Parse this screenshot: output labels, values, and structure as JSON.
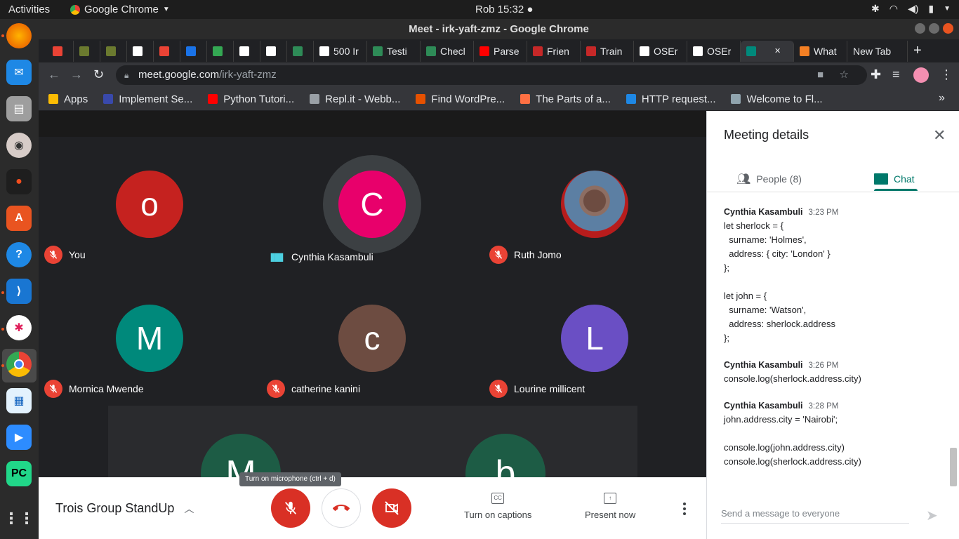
{
  "os": {
    "activities": "Activities",
    "app_name": "Google Chrome",
    "clock": "Rob 15:32 ●"
  },
  "window": {
    "title": "Meet - irk-yaft-zmz - Google Chrome"
  },
  "tabs": [
    {
      "label": "",
      "color": "#ea4335"
    },
    {
      "label": "",
      "color": "#6b7a2f"
    },
    {
      "label": "",
      "color": "#6b7a2f"
    },
    {
      "label": "",
      "color": "#ffffff"
    },
    {
      "label": "",
      "color": "#ea4335"
    },
    {
      "label": "",
      "color": "#1a73e8"
    },
    {
      "label": "",
      "color": "#34a853"
    },
    {
      "label": "",
      "color": "#ffffff"
    },
    {
      "label": "",
      "color": "#ffffff"
    },
    {
      "label": "",
      "color": "#2e8b57"
    },
    {
      "label": "500 Ir",
      "color": "#ffffff"
    },
    {
      "label": "Testi",
      "color": "#2e8b57"
    },
    {
      "label": "Checl",
      "color": "#2e8b57"
    },
    {
      "label": "Parse",
      "color": "#ff0000"
    },
    {
      "label": "Frien",
      "color": "#c62828"
    },
    {
      "label": "Train",
      "color": "#c62828"
    },
    {
      "label": "OSEr",
      "color": "#ffffff"
    },
    {
      "label": "OSEr",
      "color": "#ffffff"
    },
    {
      "label": "",
      "color": "#00897b"
    },
    {
      "label": "What",
      "color": "#f48024"
    },
    {
      "label": "New Tab",
      "color": ""
    }
  ],
  "omnibox": {
    "host": "meet.google.com",
    "path": "/irk-yaft-zmz"
  },
  "bookmarks": [
    {
      "label": "Apps",
      "color": "#fbbc04"
    },
    {
      "label": "Implement Se...",
      "color": "#3949ab"
    },
    {
      "label": "Python Tutori...",
      "color": "#ff0000"
    },
    {
      "label": "Repl.it - Webb...",
      "color": "#9aa0a6"
    },
    {
      "label": "Find WordPre...",
      "color": "#e65100"
    },
    {
      "label": "The Parts of a...",
      "color": "#ff7043"
    },
    {
      "label": "HTTP request...",
      "color": "#1e88e5"
    },
    {
      "label": "Welcome to Fl...",
      "color": "#90a4ae"
    }
  ],
  "participants": [
    {
      "initial": "o",
      "name": "You",
      "color": "#c5221f",
      "muted": true
    },
    {
      "initial": "C",
      "name": "Cynthia Kasambuli",
      "color": "#e8006b",
      "muted": false,
      "speaking": true
    },
    {
      "initial": "",
      "name": "Ruth Jomo",
      "color": "#b71c1c",
      "muted": true,
      "photo": true
    },
    {
      "initial": "M",
      "name": "Mornica Mwende",
      "color": "#00897b",
      "muted": true
    },
    {
      "initial": "c",
      "name": "catherine kanini",
      "color": "#6d4c41",
      "muted": true
    },
    {
      "initial": "L",
      "name": "Lourine millicent",
      "color": "#6a4fc4",
      "muted": true
    },
    {
      "initial": "M",
      "name": "",
      "color": "#1d5c45"
    },
    {
      "initial": "b",
      "name": "",
      "color": "#1d5c45"
    }
  ],
  "controls": {
    "meeting_title": "Trois Group StandUp",
    "tooltip": "Turn on microphone (ctrl + d)",
    "captions": "Turn on captions",
    "present": "Present now",
    "captions_icon": "CC"
  },
  "panel": {
    "title": "Meeting details",
    "people_tab": "People (8)",
    "chat_tab": "Chat",
    "send_placeholder": "Send a message to everyone"
  },
  "messages": [
    {
      "sender": "Cynthia Kasambuli",
      "time": "3:23 PM",
      "lines": [
        "let sherlock = {",
        "  surname: 'Holmes',",
        "  address: { city: 'London' }",
        "};",
        " ",
        "let john = {",
        "  surname: 'Watson',",
        "  address: sherlock.address",
        "};"
      ]
    },
    {
      "sender": "Cynthia Kasambuli",
      "time": "3:26 PM",
      "lines": [
        "console.log(sherlock.address.city)"
      ]
    },
    {
      "sender": "Cynthia Kasambuli",
      "time": "3:28 PM",
      "lines": [
        "john.address.city = 'Nairobi';",
        " ",
        "console.log(john.address.city)",
        "console.log(sherlock.address.city)"
      ]
    }
  ]
}
